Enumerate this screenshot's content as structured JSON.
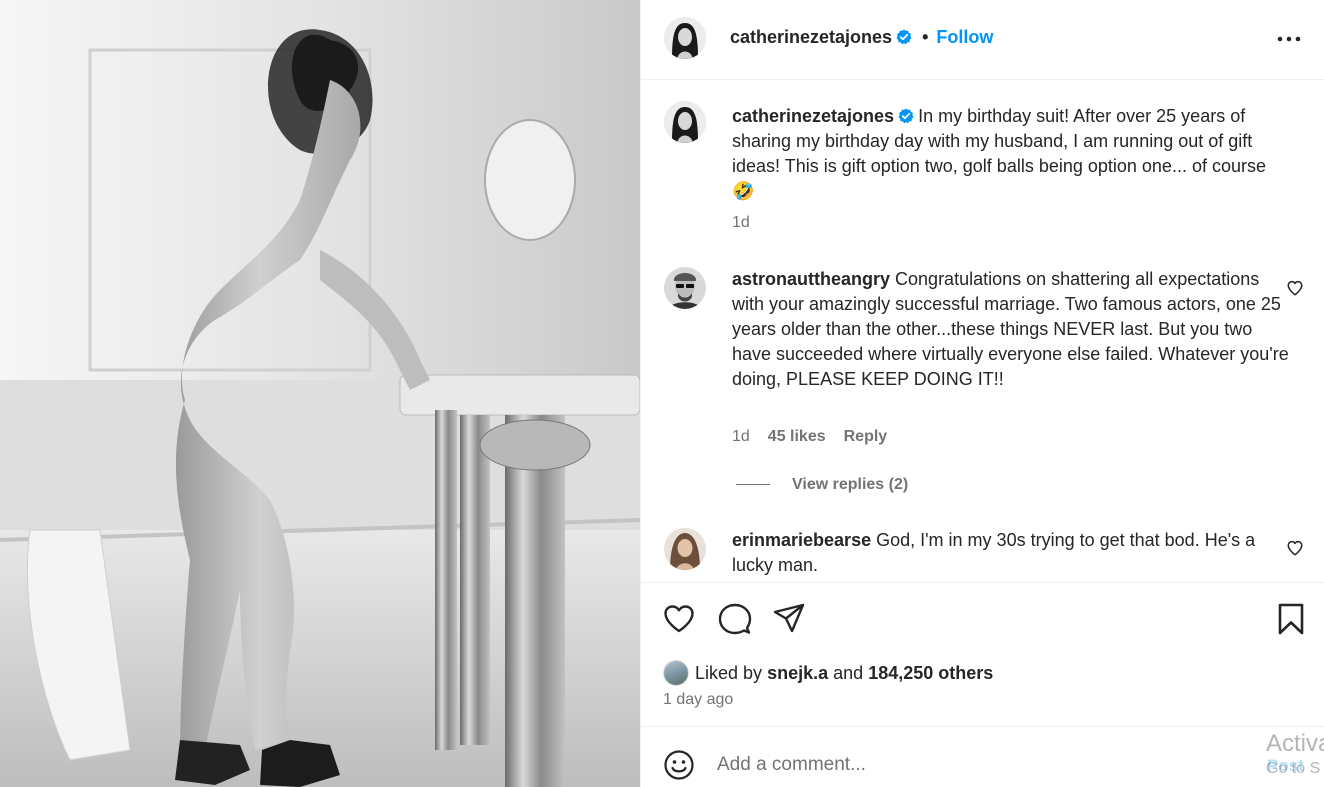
{
  "post": {
    "author": "catherinezetajones",
    "follow_label": "Follow",
    "separator": "•",
    "caption": "In my birthday suit! After over 25 years of sharing my birthday day with my husband, I am running out of gift ideas! This is gift option two, golf balls being option one... of course 🤣",
    "caption_age": "1d"
  },
  "comments": [
    {
      "username": "astronauttheangry",
      "text": "Congratulations on shattering all expectations with your amazingly successful marriage. Two famous actors, one 25 years older than the other...these things NEVER last. But you two have succeeded where virtually everyone else failed. Whatever you're doing, PLEASE KEEP DOING IT!!",
      "age": "1d",
      "likes": "45 likes",
      "reply_label": "Reply",
      "view_replies": "View replies (2)"
    },
    {
      "username": "erinmariebearse",
      "text": "God, I'm in my 30s trying to get that bod. He's a lucky man."
    }
  ],
  "likes": {
    "prefix": "Liked by",
    "user": "snejk.a",
    "joiner": "and",
    "others": "184,250 others"
  },
  "posted_ago": "1 day ago",
  "add_comment": {
    "placeholder": "Add a comment...",
    "post_label": "Post"
  },
  "watermark": {
    "line1": "Activa",
    "line2": "Go to S"
  },
  "colors": {
    "accent": "#0095f6",
    "verified": "#0095f6",
    "text": "#262626",
    "muted": "#737373"
  }
}
